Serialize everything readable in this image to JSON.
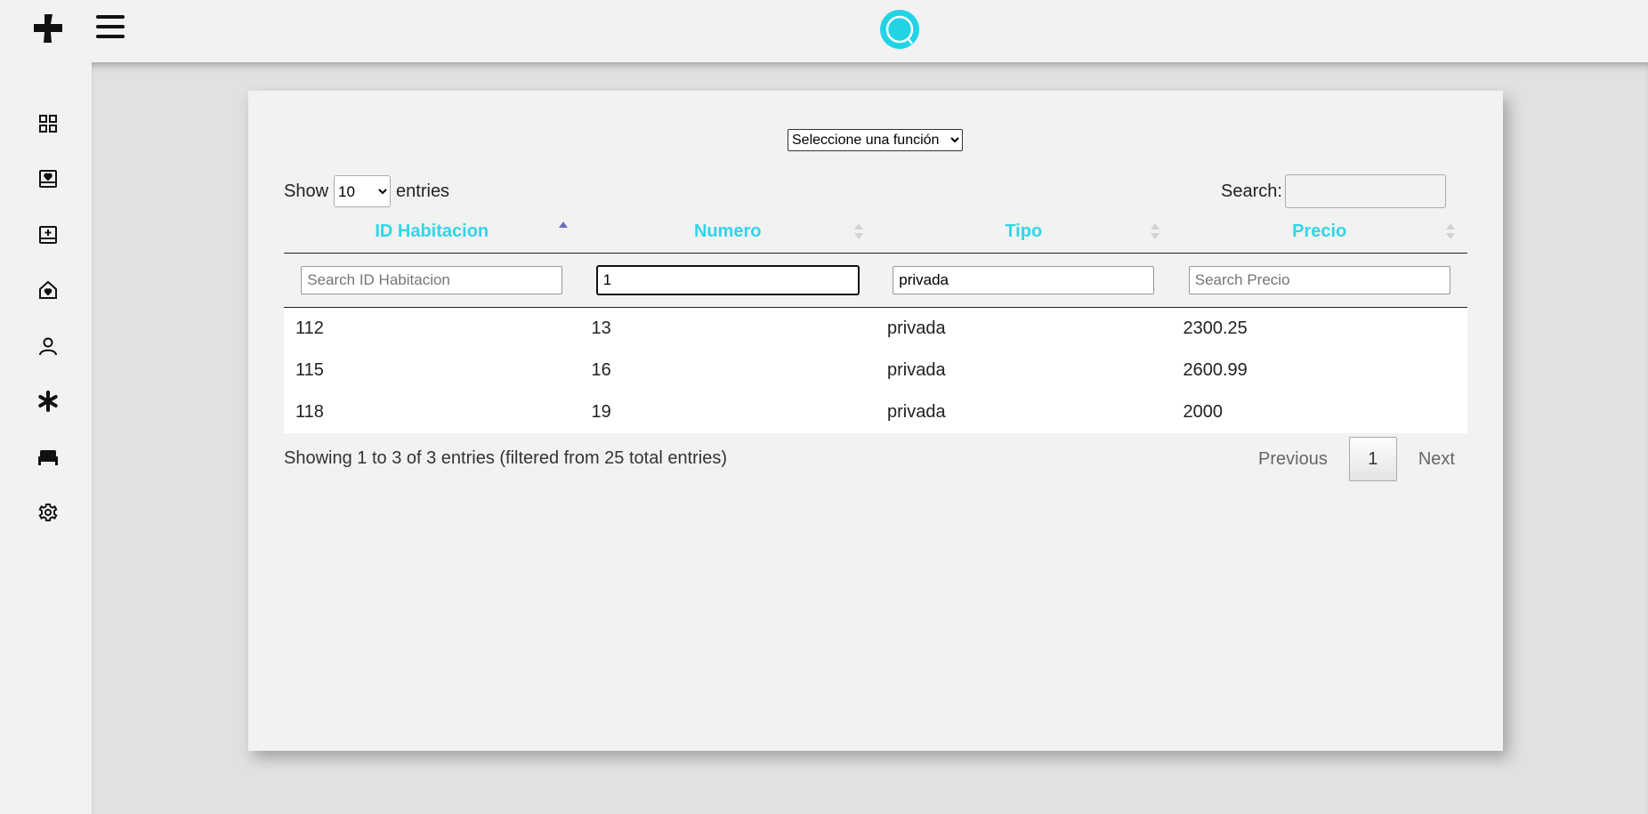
{
  "header": {
    "logo_icon": "plus-icon",
    "menu_icon": "hamburger-icon",
    "search_icon": "search-icon",
    "accent_color": "#22d3e6"
  },
  "sidebar": {
    "items": [
      {
        "icon": "dashboard-grid-icon"
      },
      {
        "icon": "heart-inbox-icon"
      },
      {
        "icon": "add-note-icon"
      },
      {
        "icon": "home-heart-icon"
      },
      {
        "icon": "user-icon"
      },
      {
        "icon": "asterisk-icon"
      },
      {
        "icon": "bed-icon"
      },
      {
        "icon": "gear-icon"
      }
    ]
  },
  "controls": {
    "function_select": "Seleccione una función",
    "show_label": "Show",
    "entries_value": "10",
    "entries_label": "entries",
    "search_label": "Search:",
    "search_value": ""
  },
  "table": {
    "columns": [
      "ID Habitacion",
      "Numero",
      "Tipo",
      "Precio"
    ],
    "filters": [
      {
        "value": "",
        "placeholder": "Search ID Habitacion"
      },
      {
        "value": "1",
        "placeholder": "Search Numero"
      },
      {
        "value": "privada",
        "placeholder": "Search Tipo"
      },
      {
        "value": "",
        "placeholder": "Search Precio"
      }
    ],
    "rows": [
      [
        "112",
        "13",
        "privada",
        "2300.25"
      ],
      [
        "115",
        "16",
        "privada",
        "2600.99"
      ],
      [
        "118",
        "19",
        "privada",
        "2000"
      ]
    ]
  },
  "footer": {
    "info": "Showing 1 to 3 of 3 entries (filtered from 25 total entries)",
    "previous": "Previous",
    "current_page": "1",
    "next": "Next"
  }
}
